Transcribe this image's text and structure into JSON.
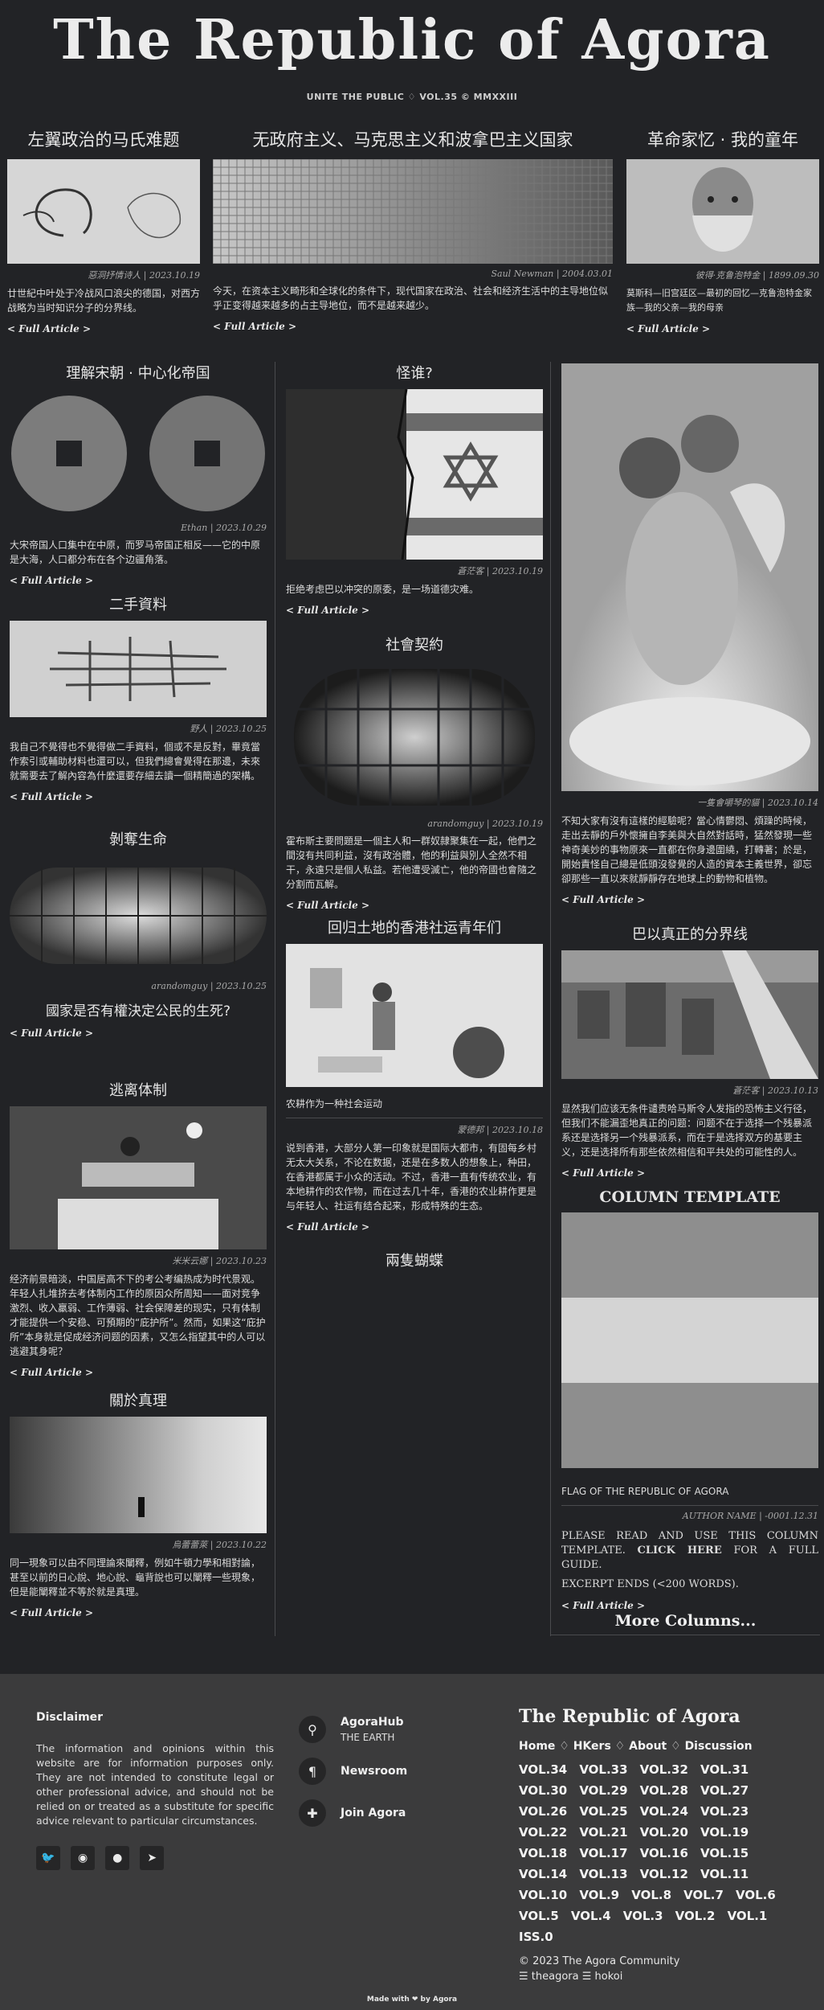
{
  "masthead": {
    "title": "The Republic of Agora",
    "subtitle": "UNITE THE PUBLIC ♢ VOL.35 © MMXXIII"
  },
  "full_article_label": "< Full Article >",
  "top": [
    {
      "title": "左翼政治的马氏难题",
      "caption": "惡洞抒情诗人 | 2023.10.19",
      "excerpt": "廿世紀中叶处于冷战风口浪尖的德国，对西方战略为当时知识分子的分界线。"
    },
    {
      "title": "无政府主义、马克思主义和波拿巴主义国家",
      "caption": "Saul Newman | 2004.03.01",
      "excerpt": "今天，在资本主义畸形和全球化的条件下，现代国家在政治、社会和经济生活中的主导地位似乎正变得越来越多的占主导地位，而不是越来越少。"
    },
    {
      "title": "革命家忆 · 我的童年",
      "caption": "彼得·克鲁泡特金 | 1899.09.30",
      "excerpt": "莫斯科—旧宫廷区—最初的回忆—克鲁泡特金家族—我的父亲—我的母亲"
    }
  ],
  "col1": [
    {
      "title": "理解宋朝 · 中心化帝国",
      "caption": "Ethan | 2023.10.29",
      "excerpt": "大宋帝国人口集中在中原，而罗马帝国正相反——它的中原是大海，人口都分布在各个边疆角落。"
    },
    {
      "title": "二手資料",
      "caption": "野人 | 2023.10.25",
      "excerpt": "我自己不覺得也不覺得做二手資料，個或不是反對，畢竟當作索引或輔助材料也還可以，但我們總會覺得在那邊，未來就需要去了解內容為什麼還要存細去讀一個精簡過的架構。"
    },
    {
      "title": "剝奪生命",
      "caption": "arandomguy | 2023.10.25",
      "subtitle": "國家是否有權決定公民的生死?"
    },
    {
      "title": "逃离体制",
      "caption": "米米云娜 | 2023.10.23",
      "excerpt": "经济前景暗淡，中国居高不下的考公考编热成为时代景观。年轻人扎堆挤去考体制内工作的原因众所周知——面对竞争激烈、收入羸弱、工作薄弱、社会保障差的现实，只有体制才能提供一个安稳、可預期的“庇护所”。然而，如果这“庇护所”本身就是促成经济问题的因素，又怎么指望其中的人可以逃避其身呢？"
    },
    {
      "title": "關於真理",
      "caption": "烏蕾蕾萊 | 2023.10.22",
      "excerpt": "同一現象可以由不同理論來闡釋，例如牛頓力學和相對論，甚至以前的日心說、地心說、龜背說也可以闡釋一些現象，但是能闡釋並不等於就是真理。"
    }
  ],
  "col2": [
    {
      "title": "怪谁?",
      "caption": "蒼茫客 | 2023.10.19",
      "excerpt": "拒绝考虑巴以冲突的原委，是一场道德灾难。"
    },
    {
      "title": "社會契約",
      "caption": "arandomguy | 2023.10.19",
      "excerpt": "霍布斯主要問題是一個主人和一群奴隷聚集在一起，他們之間沒有共同利益，沒有政治體，他的利益與別人全然不相干，永遠只是個人私益。若他遭受滅亡，他的帝國也會隨之分割而瓦解。"
    },
    {
      "title": "回归土地的香港社运青年们",
      "caption": "蒙德邦 | 2023.10.18",
      "subtitle": "农耕作为一种社会运动",
      "excerpt": "说到香港，大部分人第一印象就是国际大都市，有固每乡村无太大关系，不论在数据，还是在多数人的想象上，种田，在香港都属于小众的活动。不过，香港一直有传统农业，有本地耕作的农作物，而在过去几十年，香港的农业耕作更是与年轻人、社运有结合起来，形成特殊的生态。"
    },
    {
      "title": "兩隻蝴蝶"
    }
  ],
  "col3": [
    {
      "caption": "一隻會嚼琴的貓 | 2023.10.14",
      "excerpt": "不知大家有沒有這樣的經驗呢？當心情鬱悶、煩躁的時候，走出去靜的戶外懷擁自李美與大自然對話時，猛然發現一些神奇美妙的事物原來一直都在你身邊圍繞，打轉著；於是，開始責怪自己總是低頭沒發覺的人造的資本主義世界，卻忘卻那些一直以來就靜靜存在地球上的動物和植物。"
    },
    {
      "title": "巴以真正的分界线",
      "caption": "蒼茫客 | 2023.10.13",
      "excerpt": "显然我们应该无条件谴责哈马斯令人发指的恐怖主义行径，但我们不能漏歪地真正的问题：问题不在于选择一个残暴派系还是选择另一个残暴派系，而在于是选择双方的基要主义，还是选择所有那些依然相信和平共处的可能性的人。"
    },
    {
      "title": "COLUMN TEMPLATE",
      "subtitle": "FLAG OF THE REPUBLIC OF AGORA",
      "caption": "AUTHOR NAME | -0001.12.31",
      "excerpt_pre": "PLEASE READ AND USE THIS COLUMN TEMPLATE.",
      "excerpt_link": "CLICK HERE",
      "excerpt_post": "FOR A FULL GUIDE.",
      "excerpt2": "EXCERPT ENDS (<200 WORDS)."
    },
    {
      "more": "More Columns..."
    }
  ],
  "footer": {
    "disclaimer_title": "Disclaimer",
    "disclaimer_text": "The information and opinions within this website are for information purposes only. They are not intended to constitute legal or other professional advice, and should not be relied on or treated as a substitute for specific advice relevant to particular circumstances.",
    "links": [
      {
        "label": "AgoraHub",
        "sub": "THE EARTH",
        "icon": "map-pin-icon"
      },
      {
        "label": "Newsroom",
        "sub": "",
        "icon": "paragraph-icon"
      },
      {
        "label": "Join Agora",
        "sub": "",
        "icon": "puzzle-icon"
      }
    ],
    "brand": "The Republic of Agora",
    "nav": [
      "Home",
      "HKers",
      "About",
      "Discussion"
    ],
    "volumes": [
      "VOL.34",
      "VOL.33",
      "VOL.32",
      "VOL.31",
      "VOL.30",
      "VOL.29",
      "VOL.28",
      "VOL.27",
      "VOL.26",
      "VOL.25",
      "VOL.24",
      "VOL.23",
      "VOL.22",
      "VOL.21",
      "VOL.20",
      "VOL.19",
      "VOL.18",
      "VOL.17",
      "VOL.16",
      "VOL.15",
      "VOL.14",
      "VOL.13",
      "VOL.12",
      "VOL.11",
      "VOL.10",
      "VOL.9",
      "VOL.8",
      "VOL.7",
      "VOL.6",
      "VOL.5",
      "VOL.4",
      "VOL.3",
      "VOL.2",
      "VOL.1",
      "ISS.0"
    ],
    "copyright": "© 2023 The Agora Community",
    "handles": "☰ theagora ☰ hokoi",
    "madewith": "Made with ❤ by Agora"
  }
}
